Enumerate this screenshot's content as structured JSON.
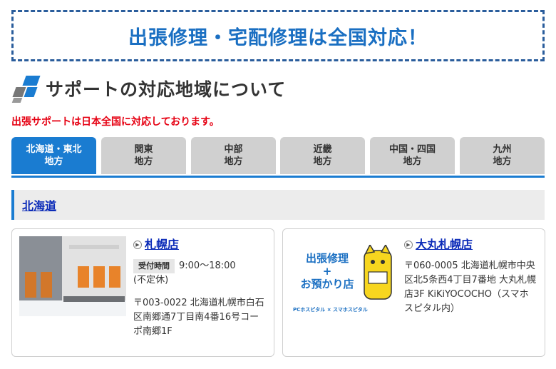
{
  "banner": {
    "text": "出張修理・宅配修理は全国対応！"
  },
  "section": {
    "title": "サポートの対応地域について",
    "notice": "出張サポートは日本全国に対応しております。"
  },
  "tabs": [
    {
      "label": "北海道・東北\n地方",
      "active": true
    },
    {
      "label": "関東\n地方",
      "active": false
    },
    {
      "label": "中部\n地方",
      "active": false
    },
    {
      "label": "近畿\n地方",
      "active": false
    },
    {
      "label": "中国・四国\n地方",
      "active": false
    },
    {
      "label": "九州\n地方",
      "active": false
    }
  ],
  "region": {
    "name": "北海道"
  },
  "stores": [
    {
      "name": "札幌店",
      "hours_label": "受付時間",
      "hours": "9:00〜18:00",
      "holiday": "(不定休)",
      "address": "〒003-0022 北海道札幌市白石区南郷通7丁目南4番16号コーポ南郷1F"
    },
    {
      "name": "大丸札幌店",
      "badge_line1": "出張修理",
      "badge_plus": "+",
      "badge_line2": "お預かり店",
      "brand1": "PCホスピタル",
      "brand_sep": "×",
      "brand2": "スマホスピタル",
      "address": "〒060-0005 北海道札幌市中央区北5条西4丁目7番地 大丸札幌店3F KiKiYOCOCHO（スマホスピタル内）"
    }
  ],
  "colors": {
    "brand_blue": "#1a7cd1",
    "banner_blue": "#1a6fc2",
    "notice_red": "#e60012",
    "link_blue": "#0b2bb8"
  }
}
